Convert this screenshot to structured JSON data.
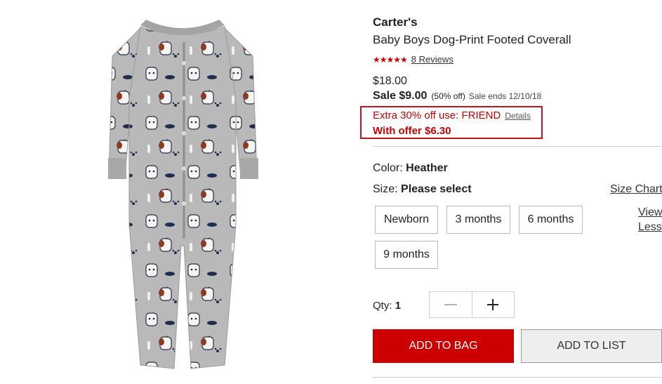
{
  "product": {
    "brand": "Carter's",
    "title": "Baby Boys Dog-Print Footed Coverall",
    "stars": "★★★★★",
    "reviews_label": "8 Reviews"
  },
  "pricing": {
    "original": "$18.00",
    "sale_price": "Sale $9.00",
    "pct_off": "(50% off)",
    "sale_ends": "Sale ends 12/10/18"
  },
  "offer": {
    "text": "Extra 30% off use: FRIEND",
    "details_label": "Details",
    "with_offer": "With offer $6.30"
  },
  "color": {
    "label": "Color:",
    "value": "Heather"
  },
  "size": {
    "label": "Size:",
    "value": "Please select",
    "chart_label": "Size Chart",
    "view_less_label": "View Less",
    "options": [
      "Newborn",
      "3 months",
      "6 months",
      "9 months"
    ]
  },
  "qty": {
    "label": "Qty:",
    "value": "1"
  },
  "actions": {
    "add_to_bag": "ADD TO BAG",
    "add_to_list": "ADD TO LIST"
  },
  "colors": {
    "accent": "#cc0000",
    "offer_border": "#c0151c",
    "garment": "#b5b5b5"
  }
}
